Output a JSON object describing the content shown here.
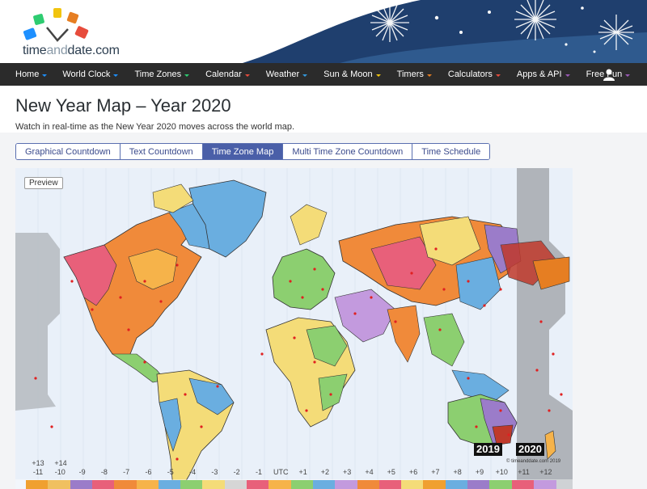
{
  "brand": {
    "logo_text_1": "time",
    "logo_text_2": "and",
    "logo_text_3": "date.com"
  },
  "nav": [
    {
      "label": "Home",
      "caret": "#1e90ff"
    },
    {
      "label": "World Clock",
      "caret": "#1e90ff"
    },
    {
      "label": "Time Zones",
      "caret": "#2ecc71"
    },
    {
      "label": "Calendar",
      "caret": "#e74c3c"
    },
    {
      "label": "Weather",
      "caret": "#3498db"
    },
    {
      "label": "Sun & Moon",
      "caret": "#f1c40f"
    },
    {
      "label": "Timers",
      "caret": "#e67e22"
    },
    {
      "label": "Calculators",
      "caret": "#e74c3c"
    },
    {
      "label": "Apps & API",
      "caret": "#9b59b6"
    },
    {
      "label": "Free Fun",
      "caret": "#9b59b6"
    }
  ],
  "nav_icons": {
    "user": "user-icon"
  },
  "page": {
    "title": "New Year Map – Year 2020",
    "subtitle": "Watch in real-time as the New Year 2020 moves across the world map."
  },
  "tabs": [
    {
      "label": "Graphical Countdown",
      "active": false
    },
    {
      "label": "Text Countdown",
      "active": false
    },
    {
      "label": "Time Zone Map",
      "active": true
    },
    {
      "label": "Multi Time Zone Countdown",
      "active": false
    },
    {
      "label": "Time Schedule",
      "active": false
    }
  ],
  "map": {
    "preview_label": "Preview",
    "copyright": "© timeanddate.com 2019",
    "year_old": "2019",
    "year_new": "2020",
    "tz_top_labels": [
      "+13",
      "+14"
    ],
    "tz_labels": [
      "-11",
      "-10",
      "-9",
      "-8",
      "-7",
      "-6",
      "-5",
      "-4",
      "-3",
      "-2",
      "-1",
      "UTC",
      "+1",
      "+2",
      "+3",
      "+4",
      "+5",
      "+6",
      "+7",
      "+8",
      "+9",
      "+10",
      "+11",
      "+12"
    ],
    "tz_colors": [
      "#f0a030",
      "#f0c060",
      "#9b7cc9",
      "#e8607a",
      "#f08a3a",
      "#f6b34a",
      "#6aaee0",
      "#8ccf70",
      "#f4dc78",
      "#d6d6d6",
      "#e8607a",
      "#f6b34a",
      "#8ccf70",
      "#6aaee0",
      "#c39ade",
      "#f08a3a",
      "#e8607a",
      "#f4dc78",
      "#f0a030",
      "#6aaee0",
      "#9b7cc9",
      "#8ccf70",
      "#e8607a",
      "#c39ade"
    ]
  }
}
